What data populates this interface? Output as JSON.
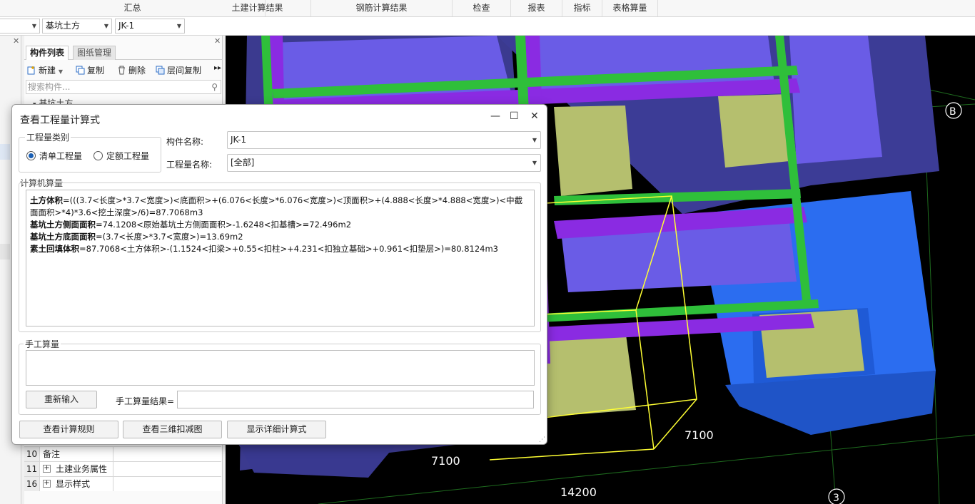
{
  "ribbon": {
    "tabs": [
      "汇总",
      "土建计算结果",
      "钢筋计算结果",
      "检查",
      "报表",
      "指标",
      "表格算量"
    ]
  },
  "selector_bar": {
    "component_type": "基坑土方",
    "component_name": "JK-1"
  },
  "component_panel": {
    "tabs": [
      "构件列表",
      "图纸管理"
    ],
    "toolbar": {
      "new": "新建",
      "copy": "复制",
      "delete": "删除",
      "floor_copy": "层间复制"
    },
    "search_placeholder": "搜索构件...",
    "tree_item": "基坑土方"
  },
  "property_grid": {
    "rows": [
      {
        "num": "10",
        "name": "备注",
        "expandable": false
      },
      {
        "num": "11",
        "name": "土建业务属性",
        "expandable": true
      },
      {
        "num": "16",
        "name": "显示样式",
        "expandable": true
      }
    ]
  },
  "viewport": {
    "dimension_labels": [
      "7100",
      "7100",
      "14200"
    ],
    "axis_labels": [
      "B",
      "3"
    ],
    "colors": {
      "slab": "#6a5ce6",
      "beam_green": "#2fbf3a",
      "beam_purple": "#8a2be2",
      "footing": "#b5bf6e",
      "pit_blue": "#1f5fe0",
      "selection": "#ffff33"
    }
  },
  "dialog": {
    "title": "查看工程量计算式",
    "controls": {
      "minimize": "—",
      "maximize": "☐",
      "close": "✕"
    },
    "category": {
      "legend": "工程量类别",
      "options": [
        "清单工程量",
        "定额工程量"
      ],
      "selected": "清单工程量"
    },
    "component_name_label": "构件名称:",
    "component_name_value": "JK-1",
    "quantity_name_label": "工程量名称:",
    "quantity_name_value": "[全部]",
    "computer_calc": {
      "legend": "计算机算量",
      "lines": [
        {
          "label": "土方体积",
          "formula": "=(((3.7<长度>*3.7<宽度>)<底面积>+(6.076<长度>*6.076<宽度>)<顶面积>+(4.888<长度>*4.888<宽度>)<中截面面积>*4)*3.6<挖土深度>/6)=87.7068m3"
        },
        {
          "label": "基坑土方侧面面积",
          "formula": "=74.1208<原始基坑土方侧面面积>-1.6248<扣基槽>=72.496m2"
        },
        {
          "label": "基坑土方底面面积",
          "formula": "=(3.7<长度>*3.7<宽度>)=13.69m2"
        },
        {
          "label": "素土回填体积",
          "formula": "=87.7068<土方体积>-(1.1524<扣梁>+0.55<扣柱>+4.231<扣独立基础>+0.961<扣垫层>)=80.8124m3"
        }
      ]
    },
    "manual_calc": {
      "legend": "手工算量",
      "reenter_button": "重新输入",
      "result_label": "手工算量结果="
    },
    "buttons": {
      "view_rules": "查看计算规则",
      "view_3d": "查看三维扣减图",
      "show_detail": "显示详细计算式"
    }
  }
}
